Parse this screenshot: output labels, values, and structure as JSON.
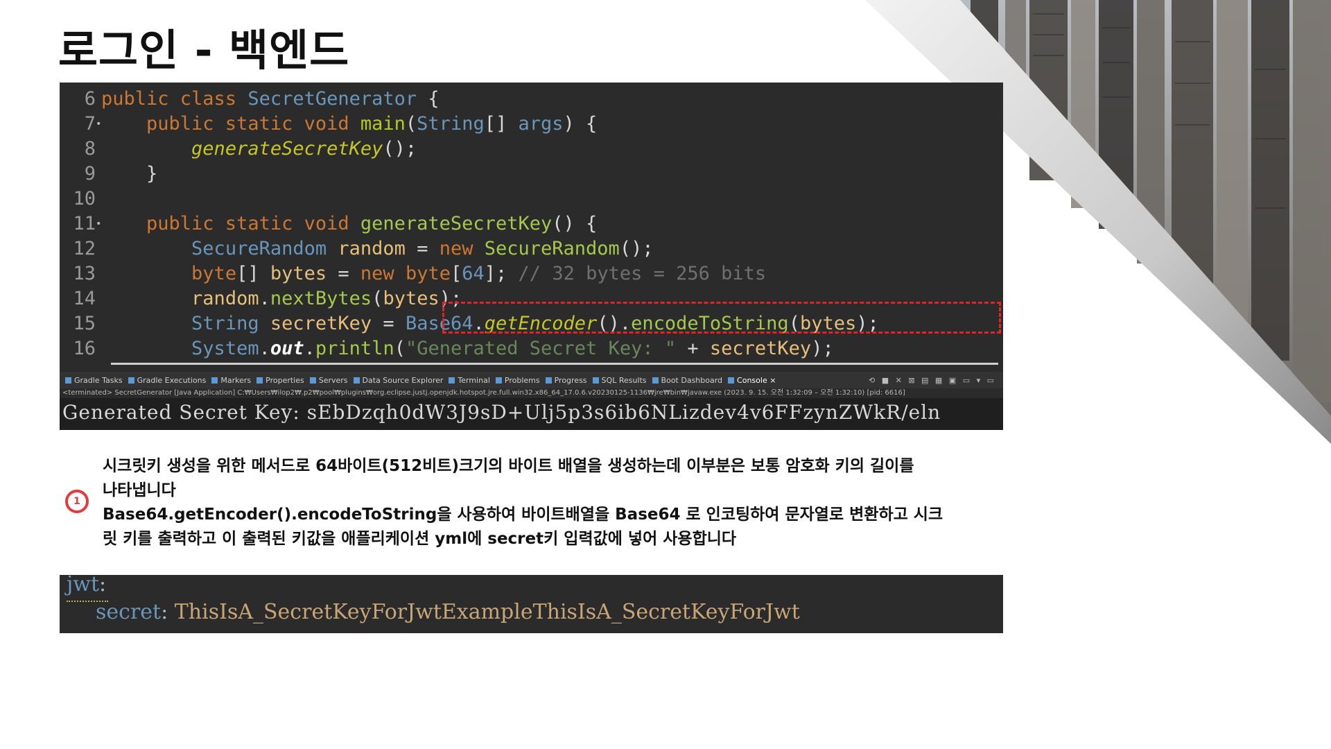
{
  "title": "로그인 - 백엔드",
  "code": {
    "lines": [
      {
        "num": "6",
        "marker": "",
        "tokens": [
          [
            "public class ",
            "kw"
          ],
          [
            "SecretGenerator",
            "ty"
          ],
          [
            " {",
            "pl"
          ]
        ]
      },
      {
        "num": "7",
        "marker": "•",
        "tokens": [
          [
            "    public static void ",
            "kw"
          ],
          [
            "main",
            "fn"
          ],
          [
            "(",
            "pl"
          ],
          [
            "String",
            "ty"
          ],
          [
            "[] ",
            "pl"
          ],
          [
            "args",
            "ty"
          ],
          [
            ") {",
            "pl"
          ]
        ]
      },
      {
        "num": "8",
        "marker": "",
        "tokens": [
          [
            "        ",
            "pl"
          ],
          [
            "generateSecretKey",
            "it"
          ],
          [
            "();",
            "pl"
          ]
        ]
      },
      {
        "num": "9",
        "marker": "",
        "tokens": [
          [
            "    }",
            "pl"
          ]
        ]
      },
      {
        "num": "10",
        "marker": "",
        "tokens": []
      },
      {
        "num": "11",
        "marker": "•",
        "tokens": [
          [
            "    public static void ",
            "kw"
          ],
          [
            "generateSecretKey",
            "mt"
          ],
          [
            "() {",
            "pl"
          ]
        ]
      },
      {
        "num": "12",
        "marker": "",
        "tokens": [
          [
            "        ",
            "pl"
          ],
          [
            "SecureRandom",
            "ty"
          ],
          [
            " ",
            "pl"
          ],
          [
            "random",
            "vr"
          ],
          [
            " = ",
            "pl"
          ],
          [
            "new ",
            "kw"
          ],
          [
            "SecureRandom",
            "mt"
          ],
          [
            "();",
            "pl"
          ]
        ]
      },
      {
        "num": "13",
        "marker": "",
        "tokens": [
          [
            "        ",
            "pl"
          ],
          [
            "byte",
            "kw"
          ],
          [
            "[] ",
            "pl"
          ],
          [
            "bytes",
            "vr"
          ],
          [
            " = ",
            "pl"
          ],
          [
            "new ",
            "kw"
          ],
          [
            "byte",
            "kw"
          ],
          [
            "[",
            "pl"
          ],
          [
            "64",
            "ty"
          ],
          [
            "]; ",
            "pl"
          ],
          [
            "// 32 bytes = 256 bits",
            "cm"
          ]
        ]
      },
      {
        "num": "14",
        "marker": "",
        "tokens": [
          [
            "        ",
            "pl"
          ],
          [
            "random",
            "vr"
          ],
          [
            ".",
            "pl"
          ],
          [
            "nextBytes",
            "mt"
          ],
          [
            "(",
            "pl"
          ],
          [
            "bytes",
            "vr"
          ],
          [
            ");",
            "pl"
          ]
        ]
      },
      {
        "num": "15",
        "marker": "",
        "tokens": [
          [
            "        ",
            "pl"
          ],
          [
            "String",
            "ty"
          ],
          [
            " ",
            "pl"
          ],
          [
            "secretKey",
            "vr"
          ],
          [
            " = ",
            "pl"
          ],
          [
            "Base64",
            "ty"
          ],
          [
            ".",
            "pl"
          ],
          [
            "getEncoder",
            "it"
          ],
          [
            "().",
            "pl"
          ],
          [
            "encodeToString",
            "mt"
          ],
          [
            "(",
            "pl"
          ],
          [
            "bytes",
            "vr"
          ],
          [
            ");",
            "pl"
          ]
        ]
      },
      {
        "num": "16",
        "marker": "",
        "tokens": [
          [
            "        ",
            "pl"
          ],
          [
            "System",
            "ty"
          ],
          [
            ".",
            "pl"
          ],
          [
            "out",
            "ob"
          ],
          [
            ".",
            "pl"
          ],
          [
            "println",
            "mt"
          ],
          [
            "(",
            "pl"
          ],
          [
            "\"Generated Secret Key: \"",
            "st"
          ],
          [
            " + ",
            "pl"
          ],
          [
            "secretKey",
            "vr"
          ],
          [
            ");",
            "pl"
          ]
        ]
      }
    ]
  },
  "console_tabs": [
    {
      "label": "Gradle Tasks"
    },
    {
      "label": "Gradle Executions"
    },
    {
      "label": "Markers"
    },
    {
      "label": "Properties"
    },
    {
      "label": "Servers"
    },
    {
      "label": "Data Source Explorer"
    },
    {
      "label": "Terminal"
    },
    {
      "label": "Problems"
    },
    {
      "label": "Progress"
    },
    {
      "label": "SQL Results"
    },
    {
      "label": "Boot Dashboard"
    },
    {
      "label": "Console ×"
    }
  ],
  "console_path": "<terminated> SecretGenerator [Java Application] C:₩Users₩ilop2₩.p2₩pool₩plugins₩org.eclipse.justj.openjdk.hotspot.jre.full.win32.x86_64_17.0.6.v20230125-1136₩jre₩bin₩javaw.exe  (2023. 9. 15. 오전 1:32:09 – 오전 1:32:10) [pid: 6616]",
  "console_output": "Generated Secret Key: sEbDzqh0dW3J9sD+Ulj5p3s6ib6NLizdev4v6FFzynZWkR/eln",
  "badge": "1",
  "description": [
    "시크릿키 생성을 위한 메서드로 64바이트(512비트)크기의 바이트 배열을 생성하는데 이부분은 보통 암호화 키의 길이를",
    "나타냅니다",
    "Base64.getEncoder().encodeToString을 사용하여 바이트배열을 Base64 로 인코팅하여 문자열로 변환하고 시크",
    "릿 키를 출력하고 이 출력된 키값을 애플리케이션 yml에 secret키 입력값에 넣어 사용합니다"
  ],
  "yml": {
    "key1": "jwt",
    "key2": "secret",
    "value": "ThisIsA_SecretKeyForJwtExampleThisIsA_SecretKeyForJwt"
  }
}
